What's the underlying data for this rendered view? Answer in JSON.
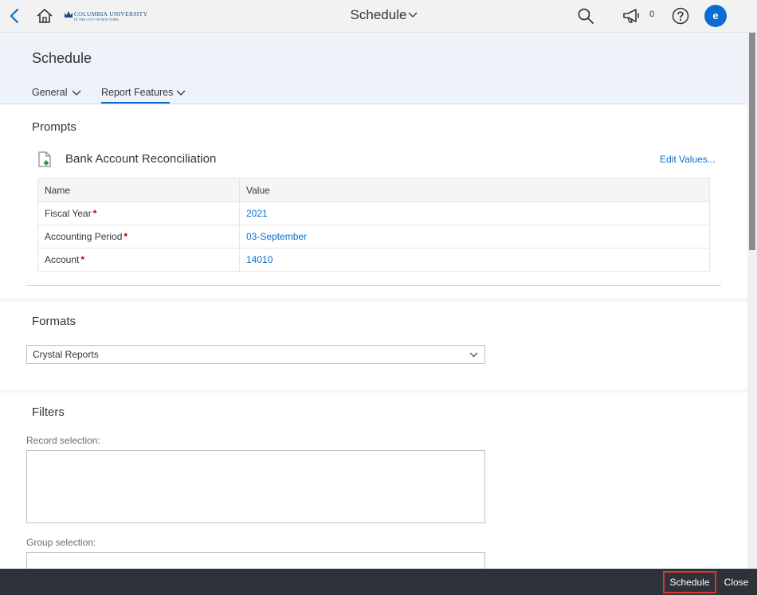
{
  "shell": {
    "logo_name": "COLUMBIA UNIVERSITY",
    "logo_sub": "IN THE CITY OF NEW YORK",
    "title": "Schedule",
    "notification_count": "0",
    "avatar_initial": "e",
    "icons": [
      "back-icon",
      "home-icon",
      "search-icon",
      "megaphone-icon",
      "help-icon",
      "chevron-down-icon"
    ]
  },
  "header": {
    "page_title": "Schedule",
    "tabs": [
      {
        "label": "General"
      },
      {
        "label": "Report Features"
      }
    ]
  },
  "prompts": {
    "section_title": "Prompts",
    "report_name": "Bank Account Reconciliation",
    "edit_values_label": "Edit Values...",
    "columns": [
      "Name",
      "Value"
    ],
    "rows": [
      {
        "name": "Fiscal Year",
        "value": "2021",
        "required": "*"
      },
      {
        "name": "Accounting Period",
        "value": "03-September",
        "required": "*"
      },
      {
        "name": "Account",
        "value": "14010",
        "required": "*"
      }
    ]
  },
  "formats": {
    "section_title": "Formats",
    "selected": "Crystal Reports"
  },
  "filters": {
    "section_title": "Filters",
    "record_selection_label": "Record selection:",
    "group_selection_label": "Group selection:"
  },
  "footer": {
    "schedule_label": "Schedule",
    "close_label": "Close"
  },
  "colors": {
    "accent": "#0a6ed1",
    "required": "#bb0000",
    "footer_bg": "#2d3339",
    "highlight_border": "#d93636"
  }
}
